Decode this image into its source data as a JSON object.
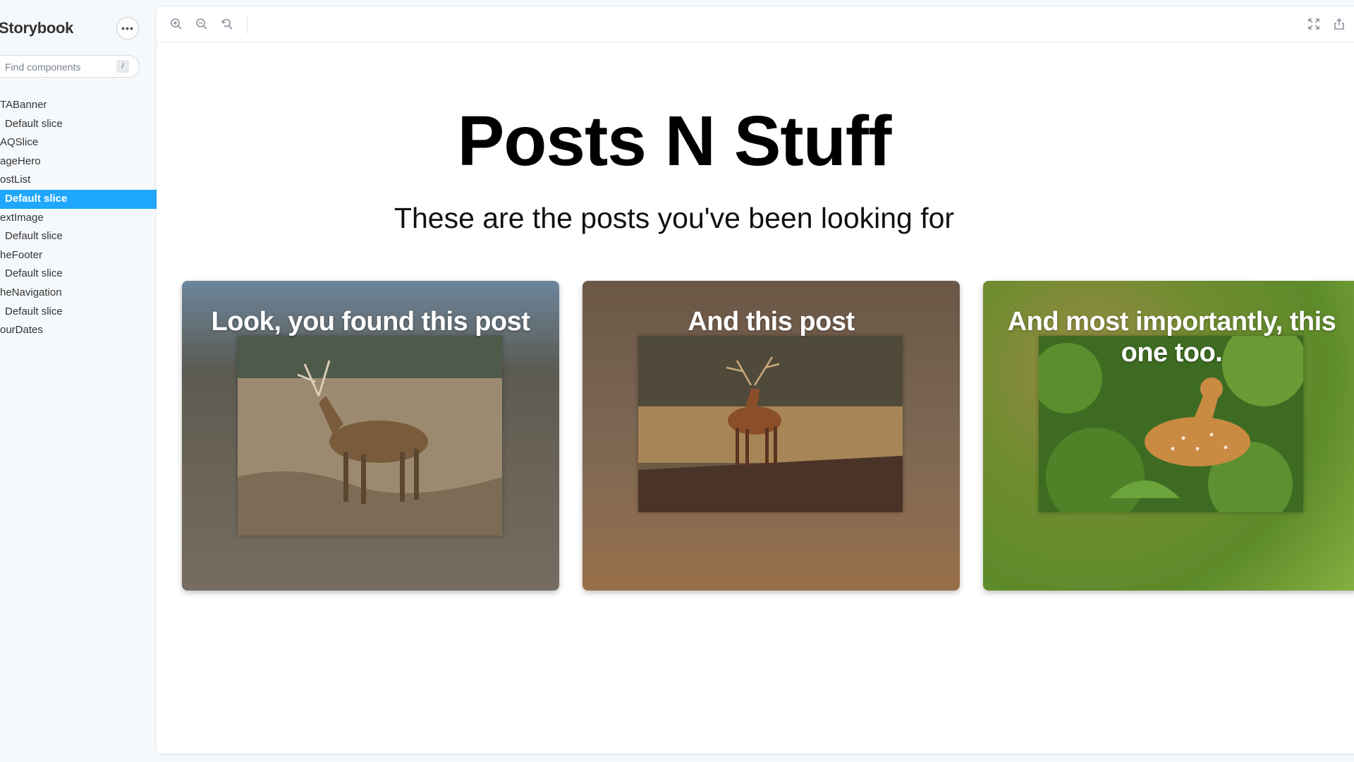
{
  "sidebar": {
    "brand": "Storybook",
    "menu_glyph": "•••",
    "search": {
      "placeholder": "Find components",
      "shortcut": "/"
    },
    "items": [
      {
        "label": "TABanner",
        "kind": "component"
      },
      {
        "label": "Default slice",
        "kind": "story"
      },
      {
        "label": "AQSlice",
        "kind": "component"
      },
      {
        "label": "ageHero",
        "kind": "component"
      },
      {
        "label": "ostList",
        "kind": "component"
      },
      {
        "label": "Default slice",
        "kind": "story",
        "selected": true
      },
      {
        "label": "extImage",
        "kind": "component"
      },
      {
        "label": "Default slice",
        "kind": "story"
      },
      {
        "label": "heFooter",
        "kind": "component"
      },
      {
        "label": "Default slice",
        "kind": "story"
      },
      {
        "label": "heNavigation",
        "kind": "component"
      },
      {
        "label": "Default slice",
        "kind": "story"
      },
      {
        "label": "ourDates",
        "kind": "component"
      }
    ]
  },
  "toolbar": {
    "icons": [
      "zoom-in-icon",
      "zoom-out-icon",
      "zoom-reset-icon",
      "fullscreen-icon",
      "share-icon"
    ]
  },
  "preview": {
    "title": "Posts N Stuff",
    "subtitle": "These are the posts you've been looking for",
    "cards": [
      {
        "title": "Look, you found this post",
        "photo": "deer-grassland"
      },
      {
        "title": "And this post",
        "photo": "stag-field"
      },
      {
        "title": "And most importantly, this one too.",
        "photo": "spotted-deer-foliage"
      }
    ]
  },
  "colors": {
    "selected": "#1ea7fd",
    "sidebar_bg": "#f6f9fc"
  }
}
